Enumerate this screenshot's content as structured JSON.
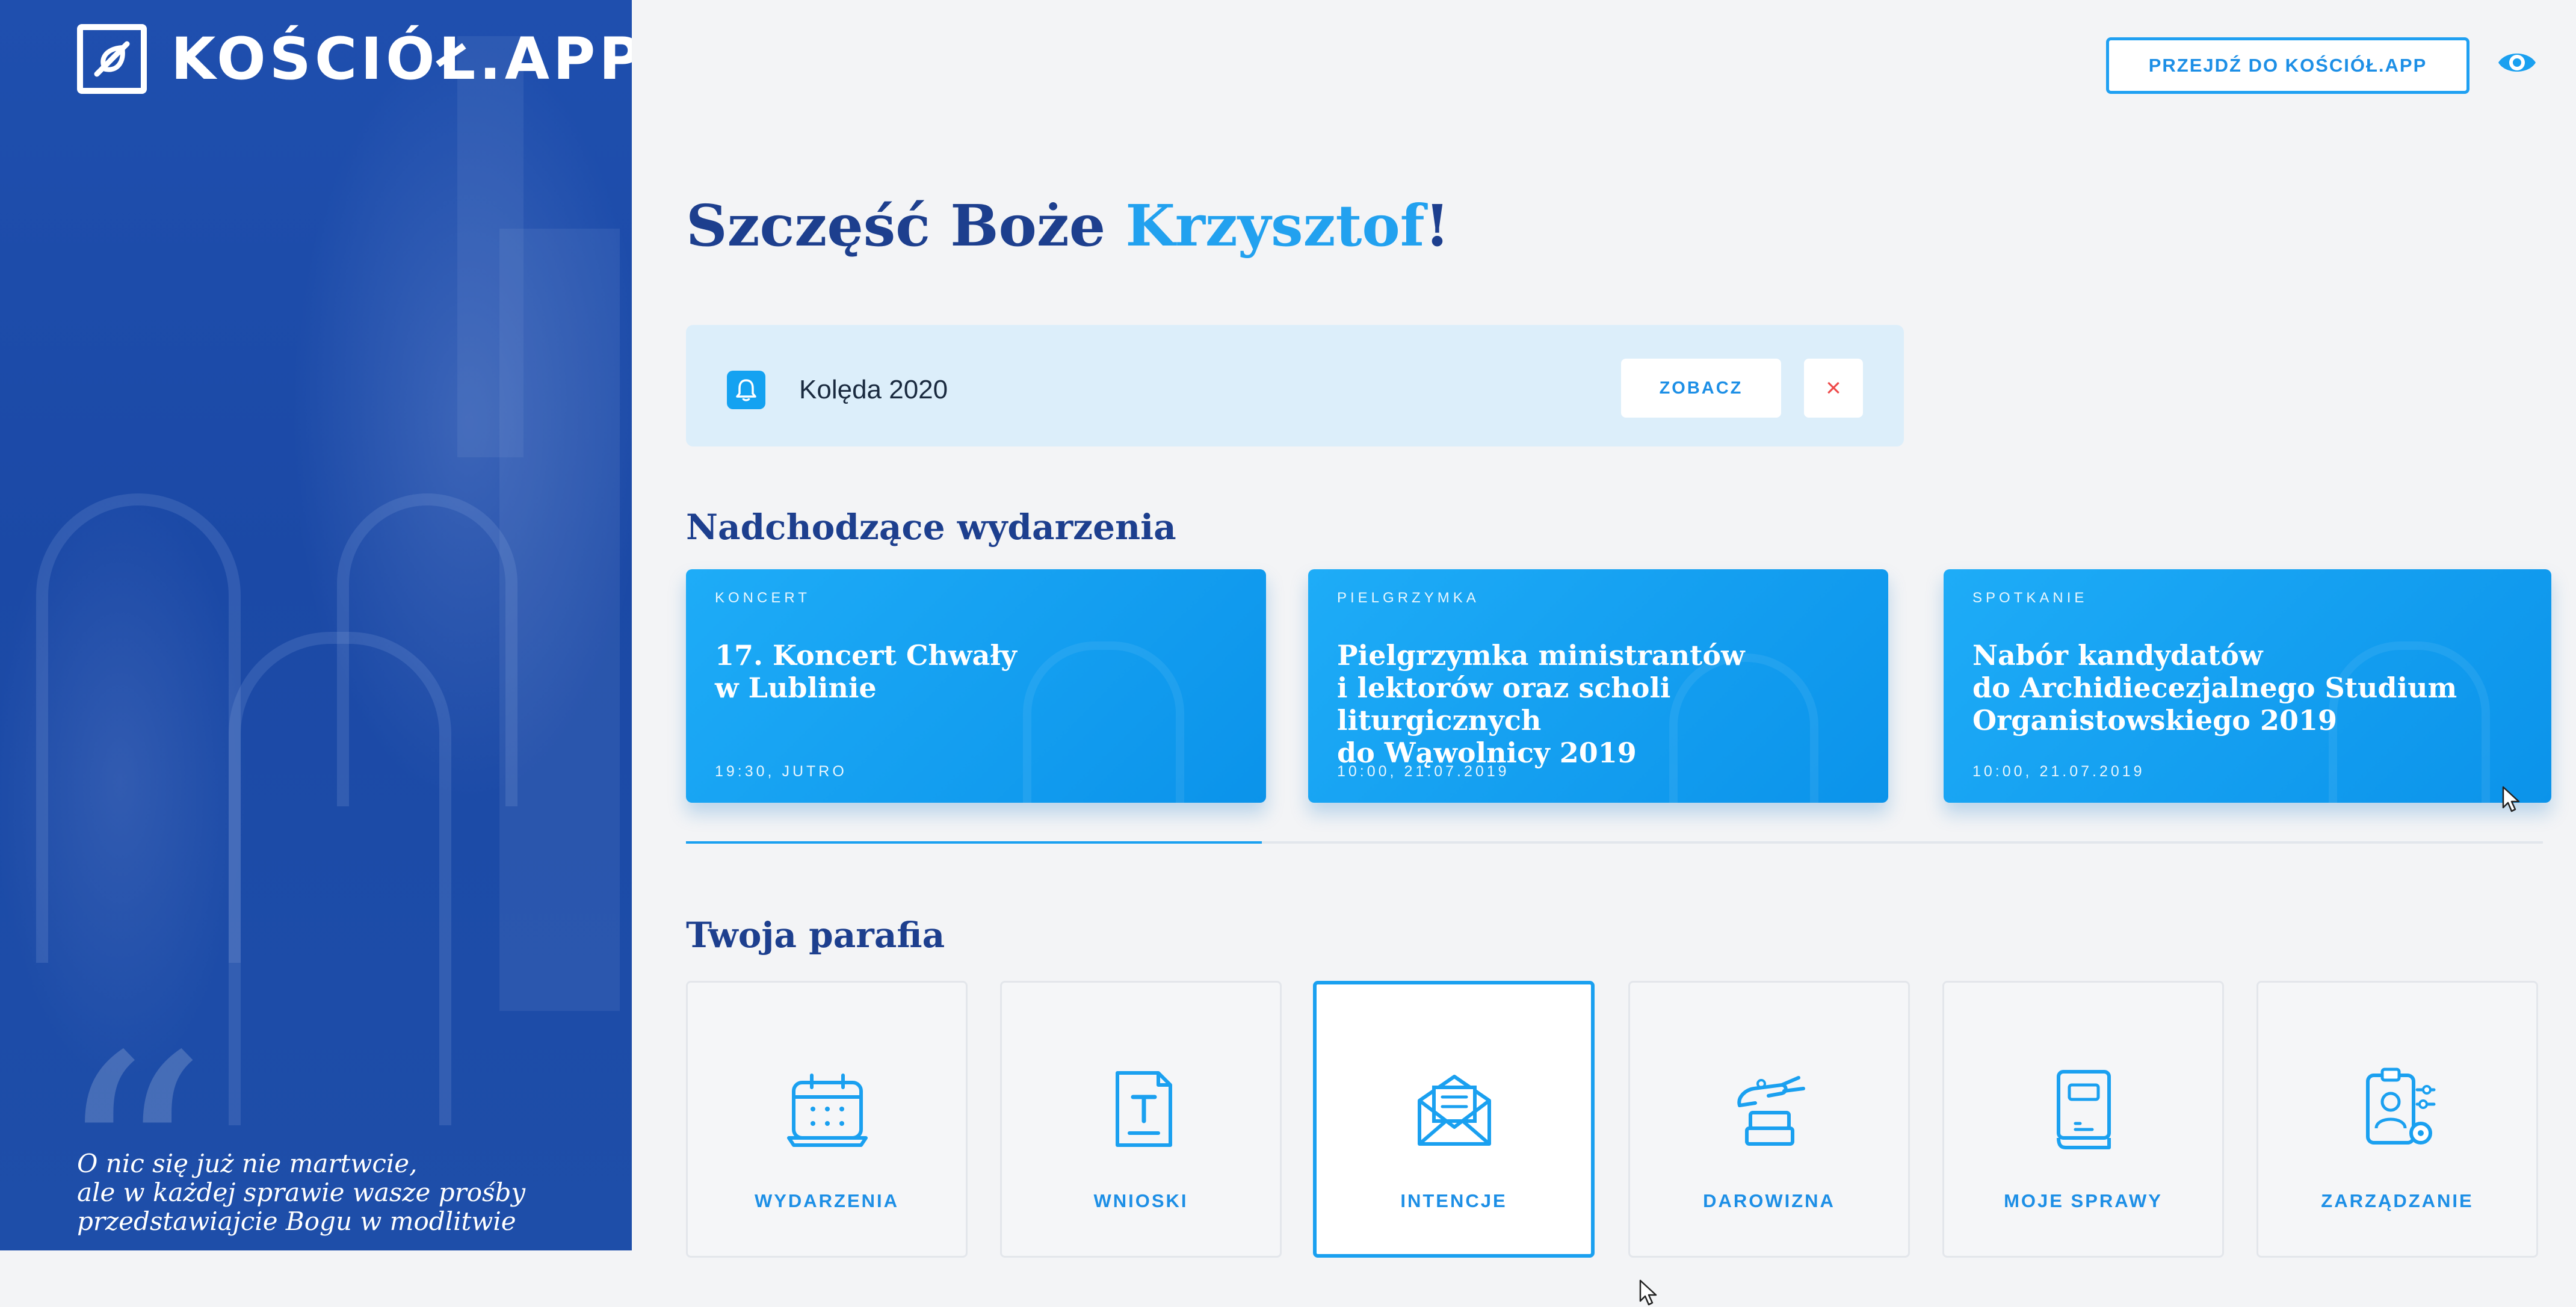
{
  "sidebar": {
    "logo_text": "KOŚCIÓŁ.APP",
    "quote_lines": [
      "O nic się już nie martwcie,",
      "ale w każdej sprawie wasze prośby",
      "przedstawiajcie Bogu w modlitwie"
    ]
  },
  "header": {
    "go_button": "PRZEJDŹ DO KOŚCIÓŁ.APP",
    "eye_icon": "eye-icon"
  },
  "greeting": {
    "prefix": "Szczęść Boże ",
    "name": "Krzysztof",
    "suffix": "!"
  },
  "notice": {
    "icon": "bell-icon",
    "label": "Kolęda 2020",
    "action": "ZOBACZ",
    "dismiss": "×"
  },
  "events_section": {
    "title": "Nadchodzące wydarzenia",
    "slider_progress": 0.31,
    "events": [
      {
        "category": "KONCERT",
        "title": "17. Koncert Chwały\nw Lublinie",
        "date": "19:30, JUTRO"
      },
      {
        "category": "PIELGRZYMKA",
        "title": "Pielgrzymka ministrantów\ni lektorów oraz scholi liturgicznych\ndo Wąwolnicy 2019",
        "date": "10:00, 21.07.2019"
      },
      {
        "category": "SPOTKANIE",
        "title": "Nabór kandydatów\ndo Archidiecezjalnego Studium\nOrganistowskiego 2019",
        "date": "10:00, 21.07.2019"
      }
    ]
  },
  "parish_section": {
    "title": "Twoja parafia",
    "tiles": [
      {
        "label": "WYDARZENIA",
        "icon": "calendar-icon"
      },
      {
        "label": "WNIOSKI",
        "icon": "document-icon"
      },
      {
        "label": "INTENCJE",
        "icon": "envelope-icon",
        "active": true
      },
      {
        "label": "DAROWIZNA",
        "icon": "donation-hand-icon"
      },
      {
        "label": "MOJE SPRAWY",
        "icon": "book-icon"
      },
      {
        "label": "ZARZĄDZANIE",
        "icon": "admin-settings-icon"
      }
    ]
  },
  "colors": {
    "sidebar_blue": "#1f4fae",
    "accent": "#1aa0f0",
    "heading": "#1d3f8e",
    "notice_bg": "#dceefa",
    "danger": "#ee4a4a"
  }
}
